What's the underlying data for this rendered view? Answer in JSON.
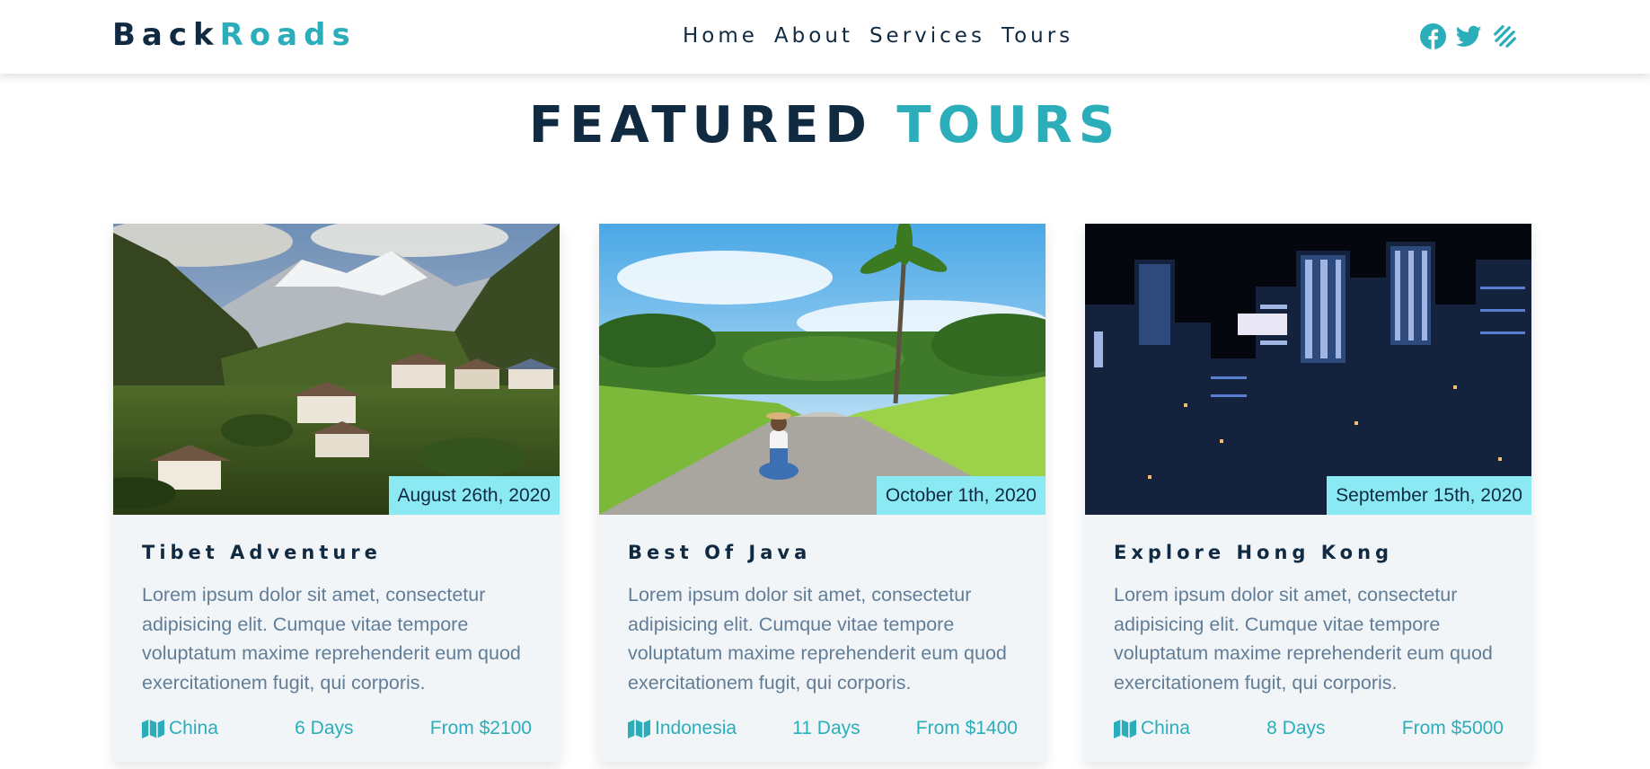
{
  "brand": {
    "part1": "Back",
    "part2": "Roads",
    "accent_color": "#2caeba"
  },
  "nav": {
    "links": [
      {
        "label": "Home"
      },
      {
        "label": "About"
      },
      {
        "label": "Services"
      },
      {
        "label": "Tours"
      }
    ],
    "social_icons": [
      "facebook-icon",
      "twitter-icon",
      "squarespace-icon"
    ]
  },
  "section": {
    "title_part1": "FEATURED",
    "title_part2": "TOURS"
  },
  "tours": [
    {
      "date": "August 26th, 2020",
      "title": "Tibet Adventure",
      "text": "Lorem ipsum dolor sit amet, consectetur adipisicing elit. Cumque vitae tempore voluptatum maxime reprehenderit eum quod exercitationem fugit, qui corporis.",
      "country": "China",
      "duration": "6 Days",
      "price": "From $2100"
    },
    {
      "date": "October 1th, 2020",
      "title": "Best Of Java",
      "text": "Lorem ipsum dolor sit amet, consectetur adipisicing elit. Cumque vitae tempore voluptatum maxime reprehenderit eum quod exercitationem fugit, qui corporis.",
      "country": "Indonesia",
      "duration": "11 Days",
      "price": "From $1400"
    },
    {
      "date": "September 15th, 2020",
      "title": "Explore Hong Kong",
      "text": "Lorem ipsum dolor sit amet, consectetur adipisicing elit. Cumque vitae tempore voluptatum maxime reprehenderit eum quod exercitationem fugit, qui corporis.",
      "country": "China",
      "duration": "8 Days",
      "price": "From $5000"
    }
  ],
  "colors": {
    "primary": "#2caeba",
    "dark": "#102a42",
    "badge": "#8be9f4",
    "text_grey": "#617d98",
    "card_bg": "#f1f5f8"
  }
}
